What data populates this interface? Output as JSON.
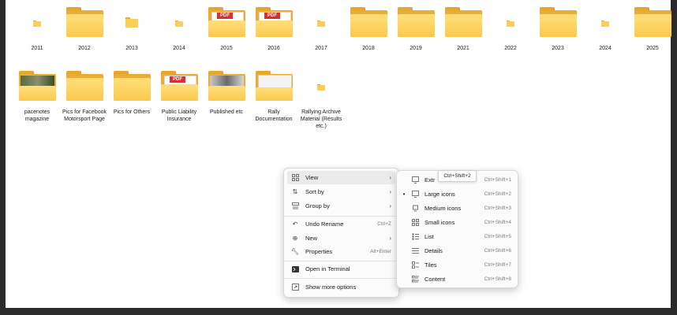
{
  "folders_row1": [
    {
      "label": "2011",
      "kind": "mini"
    },
    {
      "label": "2012",
      "kind": "folder"
    },
    {
      "label": "2013",
      "kind": "mid"
    },
    {
      "label": "2014",
      "kind": "mini"
    },
    {
      "label": "2015",
      "kind": "pdf"
    },
    {
      "label": "2016",
      "kind": "pdf"
    },
    {
      "label": "2017",
      "kind": "mini"
    },
    {
      "label": "2018",
      "kind": "folder"
    },
    {
      "label": "2019",
      "kind": "folder"
    },
    {
      "label": "2021",
      "kind": "folder"
    },
    {
      "label": "2022",
      "kind": "mini"
    },
    {
      "label": "2023",
      "kind": "folder"
    },
    {
      "label": "2024",
      "kind": "mini"
    },
    {
      "label": "2025",
      "kind": "folder"
    }
  ],
  "folders_row2": [
    {
      "label": "pacenotes magazine",
      "kind": "photo"
    },
    {
      "label": "Pics for Facebook Motorsport Page",
      "kind": "folder"
    },
    {
      "label": "Pics for Others",
      "kind": "folder"
    },
    {
      "label": "Public Liability Insurance",
      "kind": "pdf"
    },
    {
      "label": "Published etc",
      "kind": "photo2"
    },
    {
      "label": "Rally Documentation",
      "kind": "doc"
    },
    {
      "label": "Rallying Archive Material (Results etc.)",
      "kind": "mini"
    }
  ],
  "pdf_badge": "PDF",
  "context_menu": {
    "view": {
      "label": "View"
    },
    "sort_by": {
      "label": "Sort by"
    },
    "group_by": {
      "label": "Group by"
    },
    "undo_rename": {
      "label": "Undo Rename",
      "shortcut": "Ctrl+Z"
    },
    "new": {
      "label": "New"
    },
    "properties": {
      "label": "Properties",
      "shortcut": "Alt+Enter"
    },
    "open_terminal": {
      "label": "Open in Terminal"
    },
    "show_more": {
      "label": "Show more options"
    }
  },
  "view_submenu": {
    "tooltip": "Ctrl+Shift+2",
    "items": [
      {
        "label": "Extr",
        "shortcut": "Ctrl+Shift+1",
        "selected": false
      },
      {
        "label": "Large icons",
        "shortcut": "Ctrl+Shift+2",
        "selected": true
      },
      {
        "label": "Medium icons",
        "shortcut": "Ctrl+Shift+3",
        "selected": false
      },
      {
        "label": "Small icons",
        "shortcut": "Ctrl+Shift+4",
        "selected": false
      },
      {
        "label": "List",
        "shortcut": "Ctrl+Shift+5",
        "selected": false
      },
      {
        "label": "Details",
        "shortcut": "Ctrl+Shift+6",
        "selected": false
      },
      {
        "label": "Tiles",
        "shortcut": "Ctrl+Shift+7",
        "selected": false
      },
      {
        "label": "Content",
        "shortcut": "Ctrl+Shift+8",
        "selected": false
      }
    ]
  }
}
